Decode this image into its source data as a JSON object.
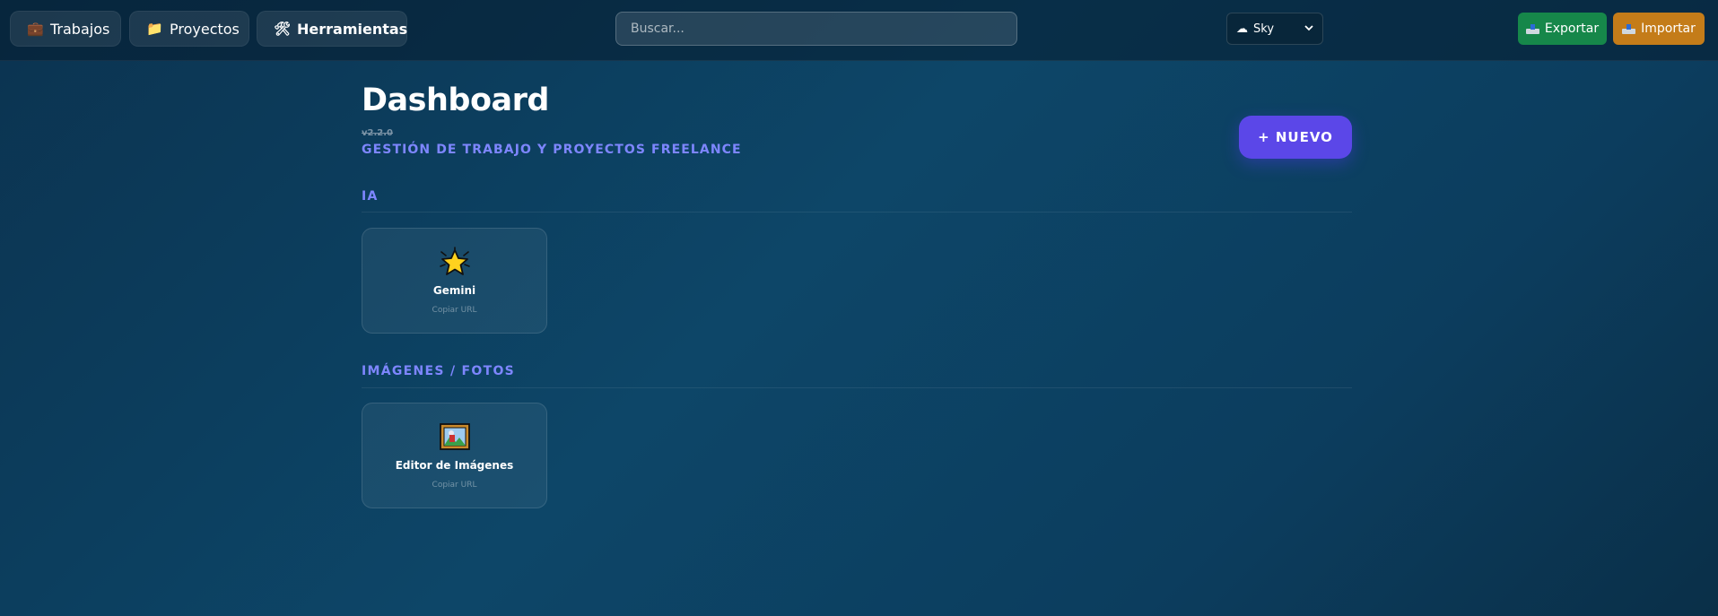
{
  "nav": {
    "items": [
      {
        "label": "Trabajos",
        "icon": "briefcase-icon",
        "glyph": "💼"
      },
      {
        "label": "Proyectos",
        "icon": "folder-icon",
        "glyph": "📁"
      },
      {
        "label": "Herramientas",
        "icon": "tools-icon",
        "glyph": "🛠",
        "active": true
      }
    ]
  },
  "search": {
    "placeholder": "Buscar..."
  },
  "theme": {
    "selected": "Sky",
    "glyph": "☁"
  },
  "actions": {
    "export_label": "Exportar",
    "import_label": "Importar"
  },
  "header": {
    "title": "Dashboard",
    "version": "v2.2.0",
    "subtitle": "GESTIÓN DE TRABAJO Y PROYECTOS FREELANCE",
    "new_button": "+ NUEVO"
  },
  "sections": [
    {
      "title": "IA",
      "tools": [
        {
          "name": "Gemini",
          "action": "Copiar URL",
          "icon": "star-icon"
        }
      ]
    },
    {
      "title": "IMÁGENES / FOTOS",
      "tools": [
        {
          "name": "Editor de Imágenes",
          "action": "Copiar URL",
          "icon": "framed-picture-icon"
        }
      ]
    }
  ],
  "colors": {
    "accent": "#7e86ff",
    "primary_button": "#5b47e8",
    "export": "#16874a",
    "import": "#c47c19",
    "background": "#0d4668"
  }
}
